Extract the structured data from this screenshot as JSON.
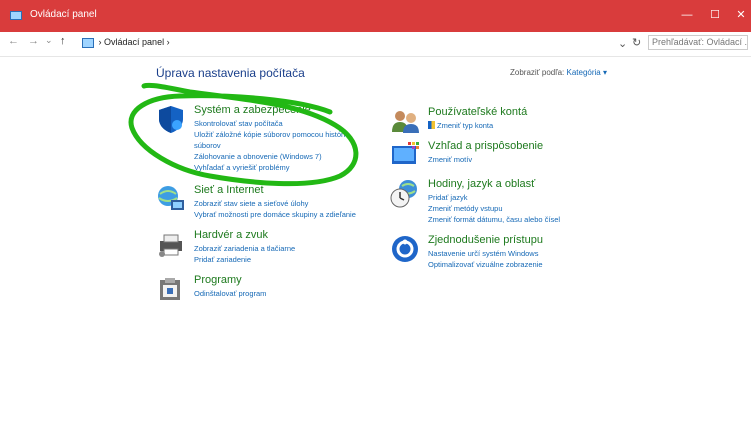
{
  "window": {
    "title": "Ovládací panel"
  },
  "address": {
    "back": "←",
    "forward": "→",
    "recent": "⌄",
    "up": "↑",
    "path_sep": "›",
    "path": "Ovládací panel",
    "path_end": "›",
    "refresh": "↻",
    "dropdown": "⌄",
    "search_placeholder": "Prehľadávať: Ovládací ..."
  },
  "main": {
    "title": "Úprava nastavenia počítača",
    "view_by_label": "Zobraziť podľa:",
    "view_by_value": "Kategória ▾"
  },
  "categories_left": [
    {
      "name": "Systém a zabezpečenie",
      "icon": "shield-icon",
      "links": [
        "Skontrolovať stav počítača",
        "Uložiť záložné kópie súborov pomocou histórie súborov",
        "Zálohovanie a obnovenie (Windows 7)",
        "Vyhľadať a vyriešiť problémy"
      ]
    },
    {
      "name": "Sieť a Internet",
      "icon": "network-icon",
      "links": [
        "Zobraziť stav siete a sieťové úlohy",
        "Vybrať možnosti pre domáce skupiny a zdieľanie"
      ]
    },
    {
      "name": "Hardvér a zvuk",
      "icon": "printer-icon",
      "links": [
        "Zobraziť zariadenia a tlačiarne",
        "Pridať zariadenie"
      ]
    },
    {
      "name": "Programy",
      "icon": "programs-icon",
      "links": [
        "Odinštalovať program"
      ]
    }
  ],
  "categories_right": [
    {
      "name": "Používateľské kontá",
      "icon": "users-icon",
      "links": [
        "Zmeniť typ konta"
      ]
    },
    {
      "name": "Vzhľad a prispôsobenie",
      "icon": "appearance-icon",
      "links": [
        "Zmeniť motív"
      ]
    },
    {
      "name": "Hodiny, jazyk a oblasť",
      "icon": "clock-globe-icon",
      "links": [
        "Pridať jazyk",
        "Zmeniť metódy vstupu",
        "Zmeniť formát dátumu, času alebo čísel"
      ]
    },
    {
      "name": "Zjednodušenie prístupu",
      "icon": "accessibility-icon",
      "links": [
        "Nastavenie určí systém Windows",
        "Optimalizovať vizuálne zobrazenie"
      ]
    }
  ],
  "colors": {
    "titlebar": "#d93c3c",
    "link": "#1669b6",
    "heading": "#1e7a1e",
    "annotation": "#22b814"
  }
}
